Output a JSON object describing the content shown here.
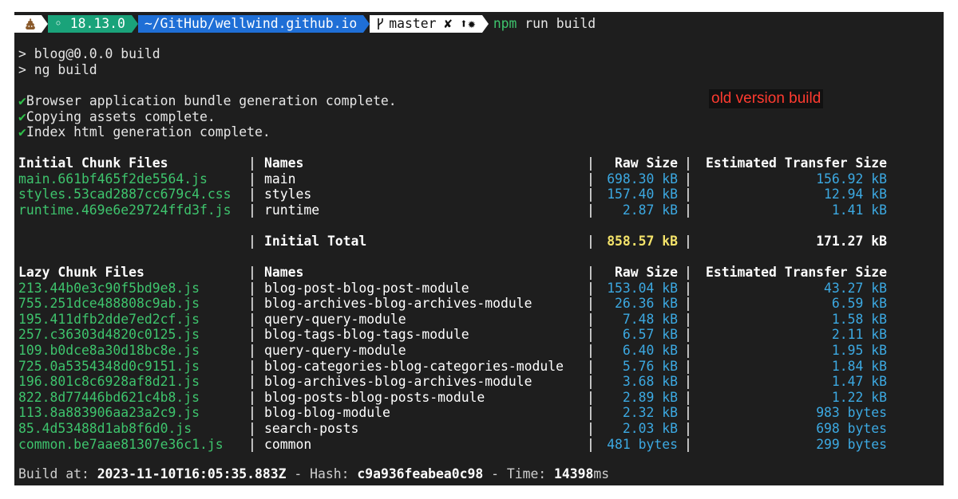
{
  "prompt": {
    "icon": "pile-of-poo-icon",
    "node_version": "◦ 18.13.0",
    "path": "~/GitHub/wellwind.github.io",
    "branch": "master ✘ ⬆✹",
    "command_bin": "npm",
    "command_args": " run build"
  },
  "output": {
    "line1": "> blog@0.0.0 build",
    "line2": "> ng build",
    "messages": [
      "Browser application bundle generation complete.",
      "Copying assets complete.",
      "Index html generation complete."
    ],
    "check_glyph": "✔"
  },
  "annotation": "old version build",
  "initial_table": {
    "headers": [
      "Initial Chunk Files",
      "Names",
      "Raw Size",
      "Estimated Transfer Size"
    ],
    "rows": [
      [
        "main.661bf465f2de5564.js",
        "main",
        "698.30 kB",
        "156.92 kB"
      ],
      [
        "styles.53cad2887cc679c4.css",
        "styles",
        "157.40 kB",
        "12.94 kB"
      ],
      [
        "runtime.469e6e29724ffd3f.js",
        "runtime",
        "2.87 kB",
        "1.41 kB"
      ]
    ],
    "total": {
      "label": "Initial Total",
      "raw": "858.57 kB",
      "transfer": "171.27 kB"
    }
  },
  "lazy_table": {
    "headers": [
      "Lazy Chunk Files",
      "Names",
      "Raw Size",
      "Estimated Transfer Size"
    ],
    "rows": [
      [
        "213.44b0e3c90f5bd9e8.js",
        "blog-post-blog-post-module",
        "153.04 kB",
        "43.27 kB"
      ],
      [
        "755.251dce488808c9ab.js",
        "blog-archives-blog-archives-module",
        "26.36 kB",
        "6.59 kB"
      ],
      [
        "195.411dfb2dde7ed2cf.js",
        "query-query-module",
        "7.48 kB",
        "1.58 kB"
      ],
      [
        "257.c36303d4820c0125.js",
        "blog-tags-blog-tags-module",
        "6.57 kB",
        "2.11 kB"
      ],
      [
        "109.b0dce8a30d18bc8e.js",
        "query-query-module",
        "6.40 kB",
        "1.95 kB"
      ],
      [
        "725.0a5354348d0c9151.js",
        "blog-categories-blog-categories-module",
        "5.76 kB",
        "1.84 kB"
      ],
      [
        "196.801c8c6928af8d21.js",
        "blog-archives-blog-archives-module",
        "3.68 kB",
        "1.47 kB"
      ],
      [
        "822.8d77446bd621c4b8.js",
        "blog-posts-blog-posts-module",
        "2.89 kB",
        "1.22 kB"
      ],
      [
        "113.8a883906aa23a2c9.js",
        "blog-blog-module",
        "2.32 kB",
        "983 bytes"
      ],
      [
        "85.4d53488d1ab8f6d0.js",
        "search-posts",
        "2.03 kB",
        "698 bytes"
      ],
      [
        "common.be7aae81307e36c1.js",
        "common",
        "481 bytes",
        "299 bytes"
      ]
    ]
  },
  "footer": {
    "build_label": "Build at: ",
    "build_at": "2023-11-10T16:05:35.883Z",
    "hash_label": " - Hash: ",
    "hash": "c9a936feabea0c98",
    "time_label": " - Time: ",
    "time_value": "14398",
    "time_unit": "ms"
  },
  "separator": "|",
  "colors": {
    "background": "#1e1e1e",
    "file_green": "#3ec46d",
    "size_blue": "#3ca9e2",
    "total_yellow": "#f4e36a",
    "annotation_red": "#ff3b30"
  }
}
